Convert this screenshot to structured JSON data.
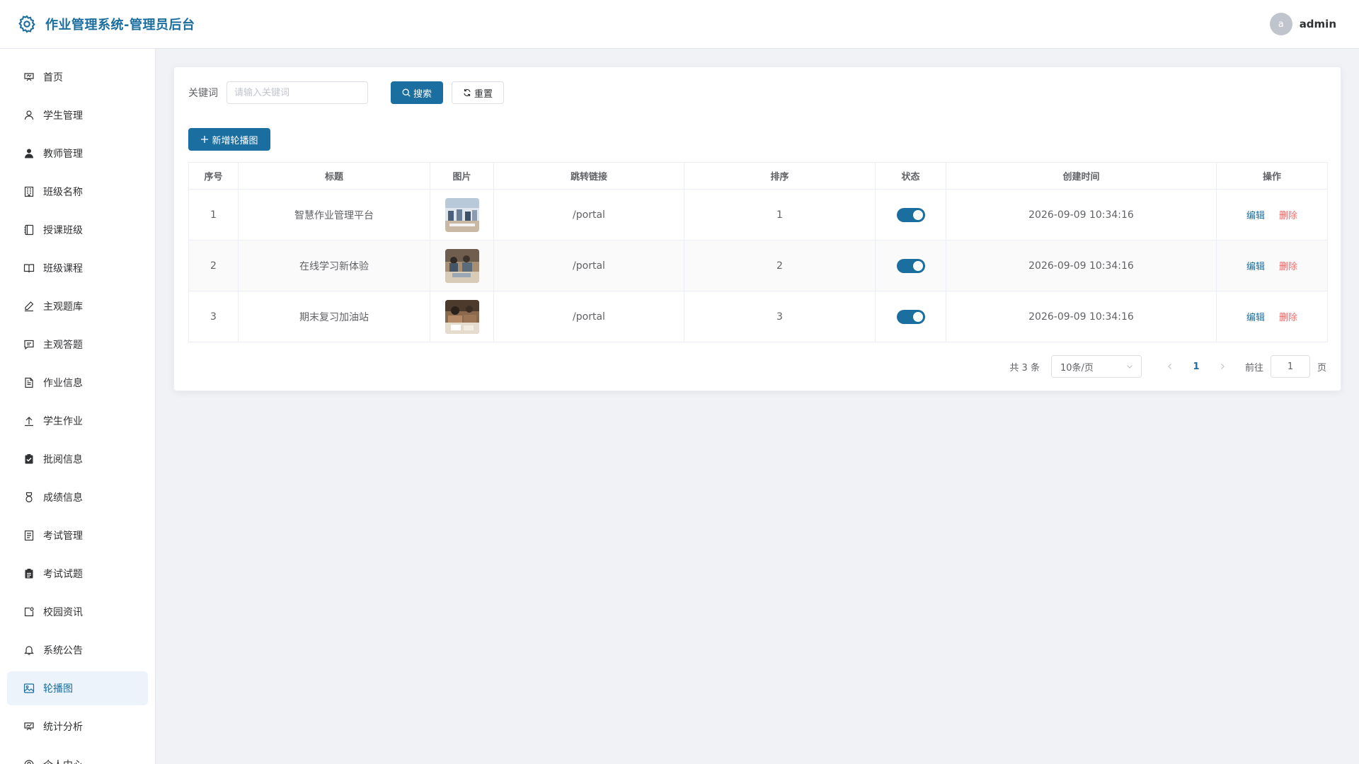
{
  "header": {
    "title": "作业管理系统-管理员后台",
    "logo_icon": "gear-icon",
    "avatar_letter": "a",
    "username": "admin"
  },
  "sidebar": {
    "items": [
      {
        "label": "首页",
        "icon": "home-icon"
      },
      {
        "label": "学生管理",
        "icon": "user-icon"
      },
      {
        "label": "教师管理",
        "icon": "teacher-icon"
      },
      {
        "label": "班级名称",
        "icon": "building-icon"
      },
      {
        "label": "授课班级",
        "icon": "notebook-icon"
      },
      {
        "label": "班级课程",
        "icon": "book-icon"
      },
      {
        "label": "主观题库",
        "icon": "edit-pen-icon"
      },
      {
        "label": "主观答题",
        "icon": "chat-icon"
      },
      {
        "label": "作业信息",
        "icon": "document-icon"
      },
      {
        "label": "学生作业",
        "icon": "upload-icon"
      },
      {
        "label": "批阅信息",
        "icon": "checked-clipboard-icon"
      },
      {
        "label": "成绩信息",
        "icon": "medal-icon"
      },
      {
        "label": "考试管理",
        "icon": "tickets-icon"
      },
      {
        "label": "考试试题",
        "icon": "list-clipboard-icon"
      },
      {
        "label": "校园资讯",
        "icon": "news-icon"
      },
      {
        "label": "系统公告",
        "icon": "bell-icon"
      },
      {
        "label": "轮播图",
        "icon": "picture-icon",
        "active": true
      },
      {
        "label": "统计分析",
        "icon": "chart-icon"
      },
      {
        "label": "个人中心",
        "icon": "user-center-icon"
      }
    ]
  },
  "search": {
    "label": "关键词",
    "placeholder": "请输入关键词",
    "search_button": "搜索",
    "reset_button": "重置"
  },
  "add_button": "新增轮播图",
  "table": {
    "columns": [
      "序号",
      "标题",
      "图片",
      "跳转链接",
      "排序",
      "状态",
      "创建时间",
      "操作"
    ],
    "rows": [
      {
        "index": "1",
        "title": "智慧作业管理平台",
        "link": "/portal",
        "sort": "1",
        "enabled": true,
        "created": "2026-09-09 10:34:16"
      },
      {
        "index": "2",
        "title": "在线学习新体验",
        "link": "/portal",
        "sort": "2",
        "enabled": true,
        "created": "2026-09-09 10:34:16"
      },
      {
        "index": "3",
        "title": "期末复习加油站",
        "link": "/portal",
        "sort": "3",
        "enabled": true,
        "created": "2026-09-09 10:34:16"
      }
    ],
    "edit_label": "编辑",
    "delete_label": "删除"
  },
  "pagination": {
    "total": "共 3 条",
    "page_size": "10条/页",
    "current_page": "1",
    "goto_label": "前往",
    "goto_value": "1",
    "goto_suffix": "页"
  },
  "colors": {
    "primary": "#1a6ea0",
    "danger": "#f56c6c",
    "active_bg": "#ecf3fb"
  }
}
